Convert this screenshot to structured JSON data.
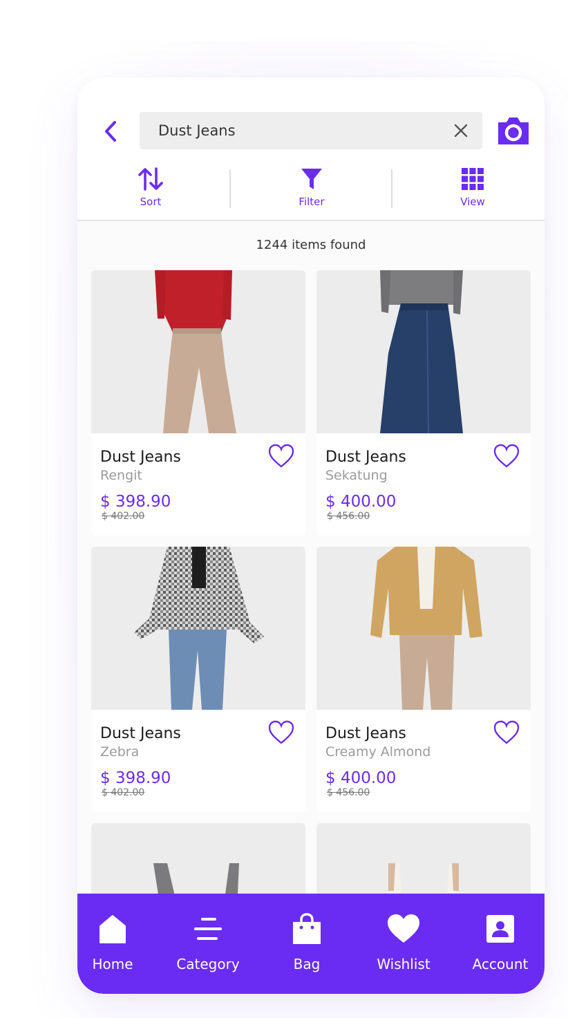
{
  "search": {
    "query": "Dust Jeans"
  },
  "toolbar": {
    "sort_label": "Sort",
    "filter_label": "Filter",
    "view_label": "View"
  },
  "results": {
    "count_text": "1244 items found"
  },
  "products": [
    {
      "name": "Dust Jeans",
      "color": "Rengit",
      "price": "$ 398.90",
      "old_price": "$ 402.00"
    },
    {
      "name": "Dust Jeans",
      "color": "Sekatung",
      "price": "$ 400.00",
      "old_price": "$ 456.00"
    },
    {
      "name": "Dust Jeans",
      "color": "Zebra",
      "price": "$ 398.90",
      "old_price": "$ 402.00"
    },
    {
      "name": "Dust Jeans",
      "color": "Creamy Almond",
      "price": "$ 400.00",
      "old_price": "$ 456.00"
    }
  ],
  "nav": {
    "items": [
      {
        "label": "Home",
        "icon": "home-icon"
      },
      {
        "label": "Category",
        "icon": "category-icon"
      },
      {
        "label": "Bag",
        "icon": "bag-icon"
      },
      {
        "label": "Wishlist",
        "icon": "heart-icon"
      },
      {
        "label": "Account",
        "icon": "account-icon"
      }
    ]
  },
  "colors": {
    "accent": "#6a2cf2",
    "background": "#fbfbfb",
    "search_bg": "#eeeeee"
  }
}
